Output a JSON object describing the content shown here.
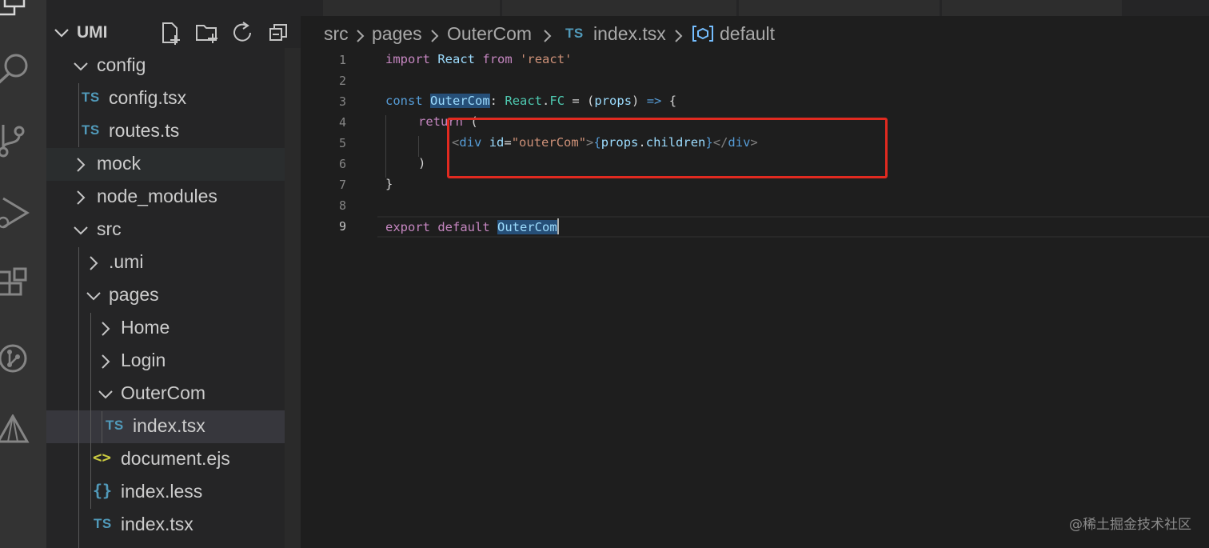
{
  "explorer": {
    "workspace": "UMI",
    "tree": [
      {
        "label": "config",
        "icon": "chevron-down-icon"
      },
      {
        "label": "config.tsx",
        "icon": "TS"
      },
      {
        "label": "routes.ts",
        "icon": "TS"
      },
      {
        "label": "mock",
        "icon": "chevron-right-icon"
      },
      {
        "label": "node_modules",
        "icon": "chevron-right-icon"
      },
      {
        "label": "src",
        "icon": "chevron-down-icon"
      },
      {
        "label": ".umi",
        "icon": "chevron-right-icon"
      },
      {
        "label": "pages",
        "icon": "chevron-down-icon"
      },
      {
        "label": "Home",
        "icon": "chevron-right-icon"
      },
      {
        "label": "Login",
        "icon": "chevron-right-icon"
      },
      {
        "label": "OuterCom",
        "icon": "chevron-down-icon"
      },
      {
        "label": "index.tsx",
        "icon": "TS",
        "selected": true
      },
      {
        "label": "document.ejs",
        "icon": "<>"
      },
      {
        "label": "index.less",
        "icon": "{}"
      },
      {
        "label": "index.tsx",
        "icon": "TS"
      }
    ],
    "ts_badge": "TS",
    "ejs_badge": "<>",
    "less_badge": "{}"
  },
  "breadcrumb": {
    "items": [
      "src",
      "pages",
      "OuterCom",
      "index.tsx",
      "default"
    ],
    "ts_badge": "TS"
  },
  "editor": {
    "line_numbers": [
      "1",
      "2",
      "3",
      "4",
      "5",
      "6",
      "7",
      "8",
      "9"
    ],
    "active_line": 9,
    "code": {
      "l1": {
        "t1": "import",
        "t2": "React",
        "t3": "from",
        "t4": "'react'"
      },
      "l3": {
        "t1": "const",
        "t2": "OuterCom",
        "t3": ":",
        "t4": "React",
        "t5": ".",
        "t6": "FC",
        "t7": " = (",
        "t8": "props",
        "t9": ") ",
        "t10": "=>",
        "t11": " {"
      },
      "l4": {
        "t1": "return",
        "t2": " ("
      },
      "l5": {
        "t1": "<",
        "t2": "div",
        "t3": "id",
        "t4": "=",
        "t5": "\"outerCom\"",
        "t6": ">",
        "t7": "{",
        "t8": "props",
        "t9": ".",
        "t10": "children",
        "t11": "}",
        "t12": "</",
        "t13": "div",
        "t14": ">"
      },
      "l6": {
        "t1": ")"
      },
      "l7": {
        "t1": "}"
      },
      "l9": {
        "t1": "export",
        "t2": "default",
        "t3": "OuterCom"
      }
    }
  },
  "colors": {
    "annotation_box": "#e12a20",
    "accent_ts": "#519aba"
  },
  "watermark": "@稀土掘金技术社区"
}
